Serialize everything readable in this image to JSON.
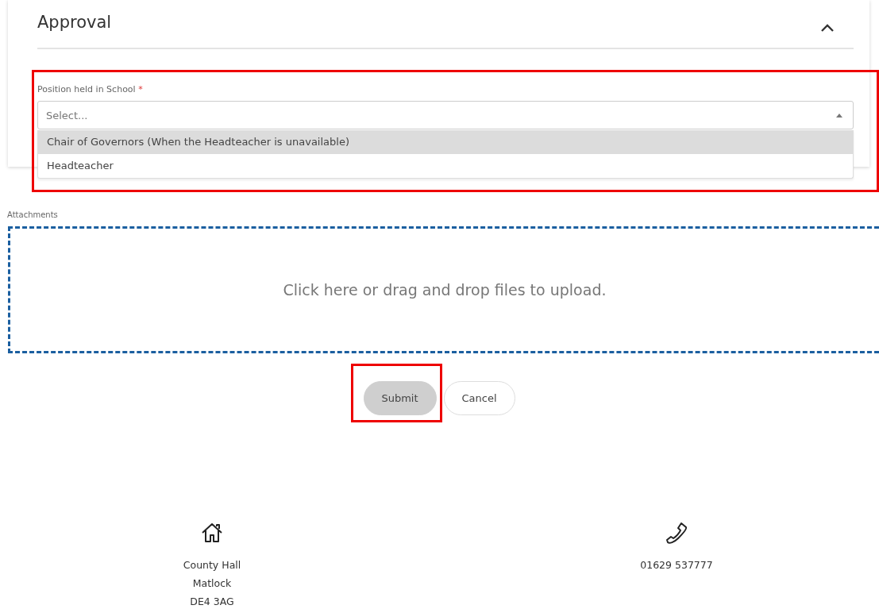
{
  "section": {
    "title": "Approval",
    "expanded": true
  },
  "position_field": {
    "label": "Position held in School",
    "required_mark": "*",
    "placeholder": "Select...",
    "open": true,
    "highlighted": true,
    "options": [
      {
        "label": "Chair of Governors (When the Headteacher is unavailable)",
        "selected": true
      },
      {
        "label": "Headteacher",
        "selected": false
      }
    ]
  },
  "attachments": {
    "label": "Attachments",
    "dropzone_text": "Click here or drag and drop files to upload."
  },
  "buttons": [
    {
      "label": "Submit",
      "kind": "primary",
      "highlighted": true
    },
    {
      "label": "Cancel",
      "kind": "secondary",
      "highlighted": false
    }
  ],
  "footer": {
    "address": [
      "County Hall",
      "Matlock",
      "DE4 3AG"
    ],
    "phone": "01629 537777"
  }
}
